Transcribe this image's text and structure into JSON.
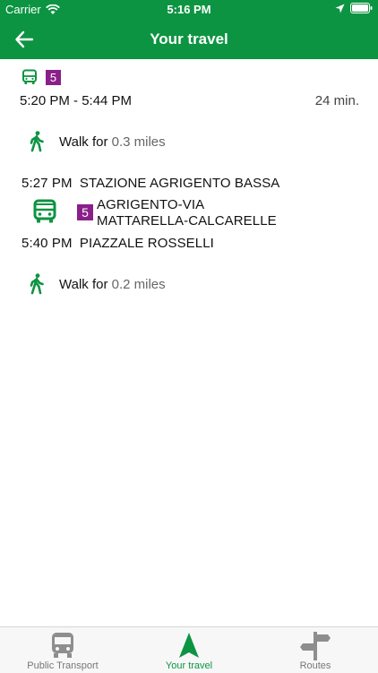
{
  "status_bar": {
    "carrier": "Carrier",
    "time": "5:16 PM"
  },
  "nav": {
    "title": "Your travel",
    "back_icon": "arrow-left-icon"
  },
  "summary": {
    "line_number": "5",
    "time_range": "5:20 PM - 5:44 PM",
    "duration": "24 min."
  },
  "steps": {
    "walk1": {
      "prefix": "Walk for",
      "distance": "0.3 miles"
    },
    "depart": {
      "time": "5:27 PM",
      "stop": "STAZIONE AGRIGENTO BASSA"
    },
    "bus": {
      "line_number": "5",
      "line_name_1": "AGRIGENTO-VIA",
      "line_name_2": "MATTARELLA-CALCARELLE"
    },
    "arrive": {
      "time": "5:40 PM",
      "stop": "PIAZZALE ROSSELLI"
    },
    "walk2": {
      "prefix": "Walk for",
      "distance": "0.2 miles"
    }
  },
  "tabs": [
    {
      "label": "Public Transport",
      "icon": "bus-icon"
    },
    {
      "label": "Your travel",
      "icon": "navigation-arrow-icon"
    },
    {
      "label": "Routes",
      "icon": "signpost-icon"
    }
  ],
  "colors": {
    "brand": "#0d9442",
    "line_badge": "#8a1f8a"
  }
}
